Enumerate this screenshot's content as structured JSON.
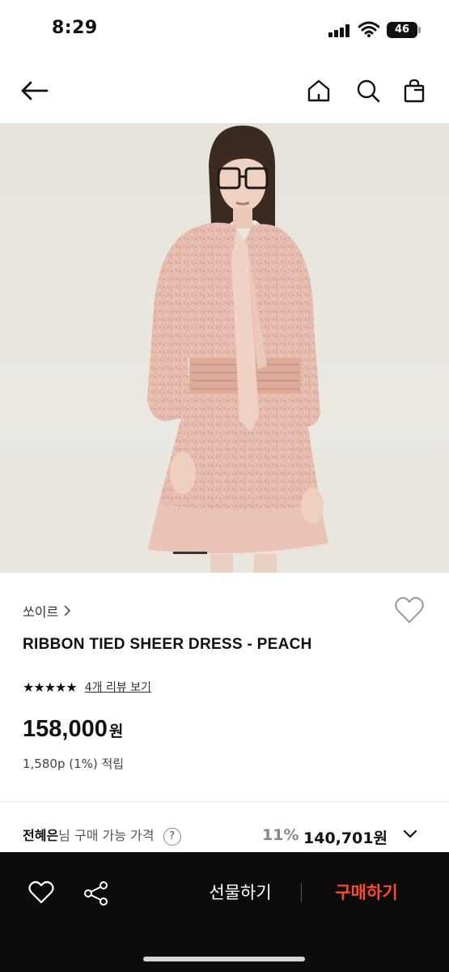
{
  "status": {
    "time": "8:29",
    "battery": "46"
  },
  "product": {
    "brand": "쏘이르",
    "name": "RIBBON TIED SHEER DRESS - PEACH",
    "stars": "★★★★★",
    "review_link": "4개 리뷰 보기",
    "price": "158,000",
    "currency": "원",
    "points": "1,580p (1%) 적립"
  },
  "member": {
    "name": "전혜은",
    "label": "님 구매 가능 가격",
    "help": "?",
    "discount": "11%",
    "price": "140,701원"
  },
  "bottom_bar": {
    "gift_label": "선물하기",
    "buy_label": "구매하기"
  },
  "colors": {
    "accent": "#ff4a2a",
    "bar_bg": "#0c0c0c",
    "dress": "#e3b9aa"
  },
  "icons": [
    "back-arrow-icon",
    "home-icon",
    "search-icon",
    "cart-icon",
    "heart-icon",
    "share-icon",
    "chevron-down-icon"
  ]
}
